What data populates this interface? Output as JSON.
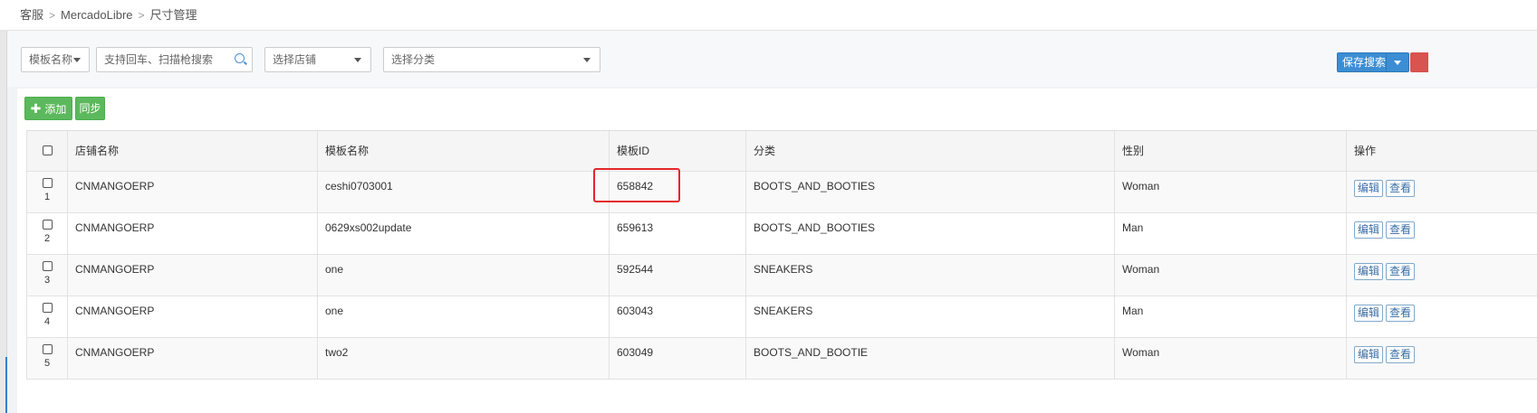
{
  "breadcrumb": [
    "客服",
    "MercadoLibre",
    "尺寸管理"
  ],
  "filters": {
    "template_name_select": "模板名称",
    "search_placeholder": "支持回车、扫描枪搜索",
    "store_select": "选择店铺",
    "category_select": "选择分类"
  },
  "toolbar": {
    "save_search_label": "保存搜索",
    "add_label": "添加",
    "sync_label": "同步"
  },
  "table": {
    "columns": [
      "店铺名称",
      "模板名称",
      "模板ID",
      "分类",
      "性别",
      "操作"
    ],
    "rows": [
      {
        "index": "1",
        "store": "CNMANGOERP",
        "template_name": "ceshi0703001",
        "template_id": "658842",
        "category": "BOOTS_AND_BOOTIES",
        "gender": "Woman"
      },
      {
        "index": "2",
        "store": "CNMANGOERP",
        "template_name": "0629xs002update",
        "template_id": "659613",
        "category": "BOOTS_AND_BOOTIES",
        "gender": "Man"
      },
      {
        "index": "3",
        "store": "CNMANGOERP",
        "template_name": "one",
        "template_id": "592544",
        "category": "SNEAKERS",
        "gender": "Woman"
      },
      {
        "index": "4",
        "store": "CNMANGOERP",
        "template_name": "one",
        "template_id": "603043",
        "category": "SNEAKERS",
        "gender": "Man"
      },
      {
        "index": "5",
        "store": "CNMANGOERP",
        "template_name": "two2",
        "template_id": "603049",
        "category": "BOOTS_AND_BOOTIE",
        "gender": "Woman"
      }
    ],
    "edit_label": "编辑",
    "view_label": "查看"
  },
  "colors": {
    "add_button": "#5cb85c",
    "save_button": "#3c8dd3",
    "highlight_box": "#e4262a",
    "danger_button": "#d9534f"
  }
}
